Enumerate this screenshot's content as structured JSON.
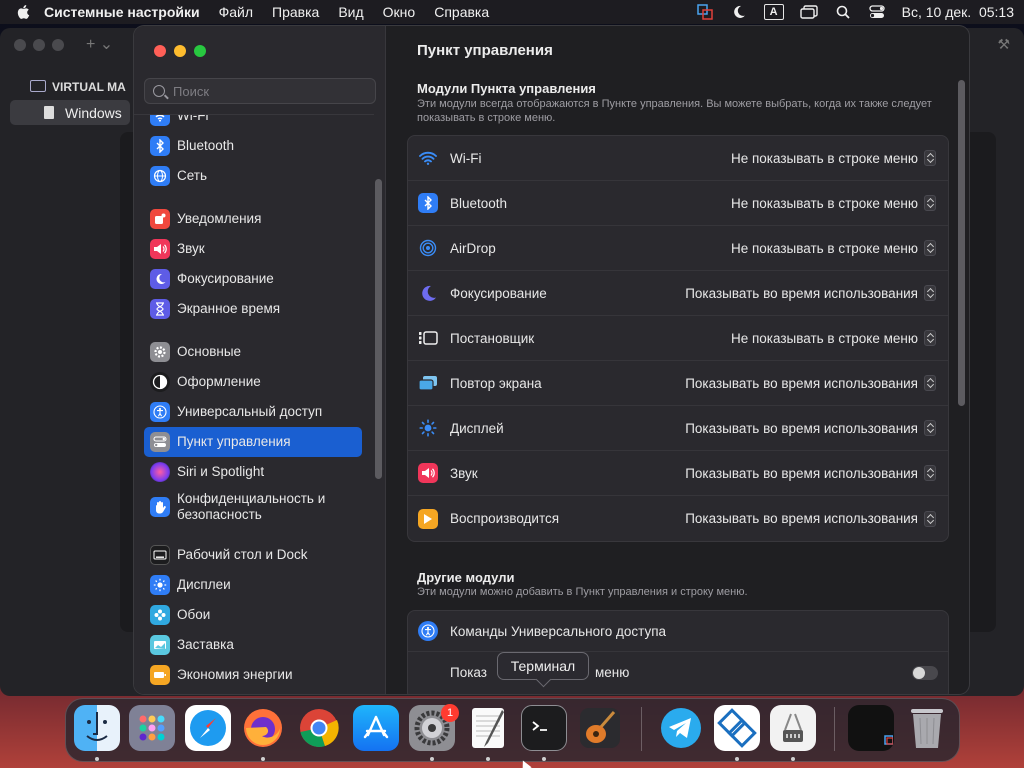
{
  "menubar": {
    "app_name": "Системные настройки",
    "items": [
      "Файл",
      "Правка",
      "Вид",
      "Окно",
      "Справка"
    ],
    "input_source": "A",
    "datetime": "Вс, 10 дек.  05:13"
  },
  "background_app": {
    "section_title": "VIRTUAL MA",
    "vm_name": "Windows"
  },
  "sidebar": {
    "search_placeholder": "Поиск",
    "items": [
      {
        "label": "Wi-Fi",
        "icon": "wifi-icon",
        "color": "#2f7df6"
      },
      {
        "label": "Bluetooth",
        "icon": "bluetooth-icon",
        "color": "#2f7df6"
      },
      {
        "label": "Сеть",
        "icon": "network-globe-icon",
        "color": "#2f7df6"
      },
      {
        "label": "Уведомления",
        "icon": "notifications-bell-icon",
        "color": "#f0483e"
      },
      {
        "label": "Звук",
        "icon": "sound-speaker-icon",
        "color": "#f0365a"
      },
      {
        "label": "Фокусирование",
        "icon": "focus-moon-icon",
        "color": "#5e5ce6"
      },
      {
        "label": "Экранное время",
        "icon": "screen-time-hourglass-icon",
        "color": "#5e5ce6"
      },
      {
        "label": "Основные",
        "icon": "general-gear-icon",
        "color": "#8e8e93"
      },
      {
        "label": "Оформление",
        "icon": "appearance-icon",
        "color": "#1c1c1e"
      },
      {
        "label": "Универсальный доступ",
        "icon": "accessibility-icon",
        "color": "#2f7df6"
      },
      {
        "label": "Пункт управления",
        "icon": "control-center-icon",
        "color": "#8e8e93"
      },
      {
        "label": "Siri и Spotlight",
        "icon": "siri-icon",
        "color": "#b04ad6"
      },
      {
        "label": "Конфиденциальность и безопасность",
        "icon": "privacy-hand-icon",
        "color": "#2f7df6"
      },
      {
        "label": "Рабочий стол и Dock",
        "icon": "desktop-dock-icon",
        "color": "#1c1c1e"
      },
      {
        "label": "Дисплеи",
        "icon": "displays-sun-icon",
        "color": "#2f7df6"
      },
      {
        "label": "Обои",
        "icon": "wallpaper-flower-icon",
        "color": "#30a8e0"
      },
      {
        "label": "Заставка",
        "icon": "screensaver-icon",
        "color": "#5ac8e0"
      },
      {
        "label": "Экономия энергии",
        "icon": "energy-saver-icon",
        "color": "#f5a623"
      }
    ]
  },
  "main": {
    "title": "Пункт управления",
    "modules_title": "Модули Пункта управления",
    "modules_desc": "Эти модули всегда отображаются в Пункте управления. Вы можете выбрать, когда их также следует показывать в строке меню.",
    "modules": [
      {
        "label": "Wi-Fi",
        "icon": "wifi-icon",
        "value": "Не показывать в строке меню"
      },
      {
        "label": "Bluetooth",
        "icon": "bluetooth-icon",
        "value": "Не показывать в строке меню"
      },
      {
        "label": "AirDrop",
        "icon": "airdrop-icon",
        "value": "Не показывать в строке меню"
      },
      {
        "label": "Фокусирование",
        "icon": "focus-moon-icon",
        "value": "Показывать во время использования"
      },
      {
        "label": "Постановщик",
        "icon": "stage-manager-icon",
        "value": "Не показывать в строке меню"
      },
      {
        "label": "Повтор экрана",
        "icon": "screen-mirroring-icon",
        "value": "Показывать во время использования"
      },
      {
        "label": "Дисплей",
        "icon": "display-brightness-icon",
        "value": "Показывать во время использования"
      },
      {
        "label": "Звук",
        "icon": "sound-speaker-icon",
        "value": "Показывать во время использования"
      },
      {
        "label": "Воспроизводится",
        "icon": "now-playing-icon",
        "value": "Показывать во время использования"
      }
    ],
    "other_title": "Другие модули",
    "other_desc": "Эти модули можно добавить в Пункт управления и строку меню.",
    "accessibility_shortcuts": "Команды Универсального доступа",
    "show_in_menu_bar_prefix": "Показ",
    "show_in_menu_bar_suffix": "меню"
  },
  "dock": {
    "tooltip": "Терминал",
    "settings_badge": "1",
    "apps": [
      "Finder",
      "Launchpad",
      "Safari",
      "Firefox",
      "Chrome",
      "App Store",
      "Системные настройки",
      "TextEdit",
      "Терминал",
      "GarageBand",
      "Telegram",
      "VirtualBox",
      "System Information",
      "Trash"
    ]
  }
}
